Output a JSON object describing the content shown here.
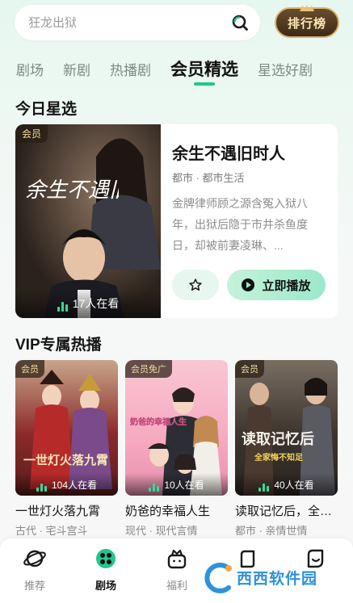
{
  "search": {
    "placeholder": "狂龙出狱"
  },
  "rank_badge": {
    "label": "排行榜"
  },
  "tabs": [
    {
      "label": "剧场",
      "active": false
    },
    {
      "label": "新剧",
      "active": false
    },
    {
      "label": "热播剧",
      "active": false
    },
    {
      "label": "会员精选",
      "active": true
    },
    {
      "label": "星选好剧",
      "active": false
    }
  ],
  "today_pick": {
    "section_title": "今日星选",
    "tag": "会员",
    "poster_title_art": "余生不遇旧时人",
    "viewers": "17人在看",
    "title": "余生不遇旧时人",
    "genre": "都市 · 都市生活",
    "description": "金牌律师顾之源含冤入狱八年，出狱后隐于市井杀鱼度日，却被前妻凌琳、...",
    "play_label": "立即播放"
  },
  "vip": {
    "section_title": "VIP专属热播",
    "items": [
      {
        "tag": "会员",
        "viewers": "104人在看",
        "title": "一世灯火落九霄",
        "genre": "古代 · 宅斗宫斗",
        "poster_art": "一世灯火落九霄"
      },
      {
        "tag": "会员免广",
        "viewers": "10人在看",
        "title": "奶爸的幸福人生",
        "genre": "现代 · 现代言情",
        "poster_art": "奶爸的幸福人生"
      },
      {
        "tag": "会员",
        "viewers": "40人在看",
        "title": "读取记忆后，全家悔不知足",
        "genre": "都市 · 亲情世情",
        "poster_art": "读取记忆后",
        "poster_sub": "全家悔不知足"
      }
    ]
  },
  "bottom_nav": [
    {
      "label": "推荐",
      "icon": "planet-icon",
      "active": false
    },
    {
      "label": "剧场",
      "icon": "film-reel-icon",
      "active": true
    },
    {
      "label": "福利",
      "icon": "gift-icon",
      "active": false
    },
    {
      "label": "",
      "icon": "square-icon",
      "active": false
    },
    {
      "label": "",
      "icon": "profile-icon",
      "active": false
    }
  ],
  "watermark": {
    "text": "西西软件园"
  },
  "colors": {
    "accent": "#22c58f",
    "badge_gold": "#d9b36a",
    "play_gradient_end": "#9be8cb"
  }
}
